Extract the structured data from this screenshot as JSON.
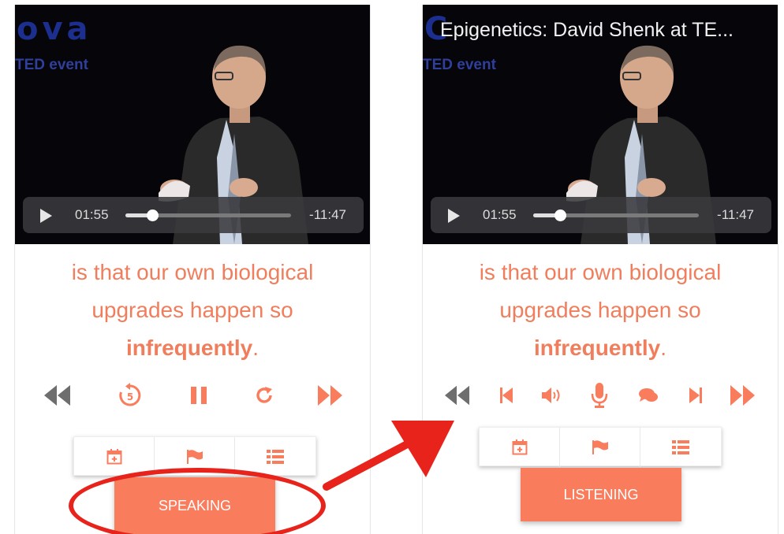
{
  "left_panel": {
    "video": {
      "logo_text": "ova",
      "event_text": "TED event",
      "current_time": "01:55",
      "remaining_time": "-11:47",
      "progress": 0.16
    },
    "subtitle": {
      "line1": "is that our own biological",
      "line2": "upgrades happen so",
      "emphasis": "infrequently",
      "end": "."
    },
    "transport_icons": [
      "fast-rewind-icon",
      "replay-5-icon",
      "pause-icon",
      "redo-icon",
      "fast-forward-icon"
    ],
    "tool_icons": [
      "calendar-plus-icon",
      "flag-icon",
      "list-icon"
    ],
    "mode_button_label": "SPEAKING"
  },
  "right_panel": {
    "video": {
      "title": "Epigenetics: David Shenk at TE...",
      "event_text": "TED event",
      "current_time": "01:55",
      "remaining_time": "-11:47",
      "progress": 0.16
    },
    "subtitle": {
      "line1": "is that our own biological",
      "line2": "upgrades happen so",
      "emphasis": "infrequently",
      "end": "."
    },
    "transport_icons": [
      "fast-rewind-icon",
      "skip-previous-icon",
      "volume-icon",
      "microphone-icon",
      "chat-icon",
      "skip-next-icon",
      "fast-forward-icon"
    ],
    "tool_icons": [
      "calendar-plus-icon",
      "flag-icon",
      "list-icon"
    ],
    "mode_button_label": "LISTENING"
  },
  "colors": {
    "accent": "#f97d5c",
    "subtitle": "#f07e5c",
    "annotation": "#e8231c",
    "video_bg": "#05050a"
  }
}
